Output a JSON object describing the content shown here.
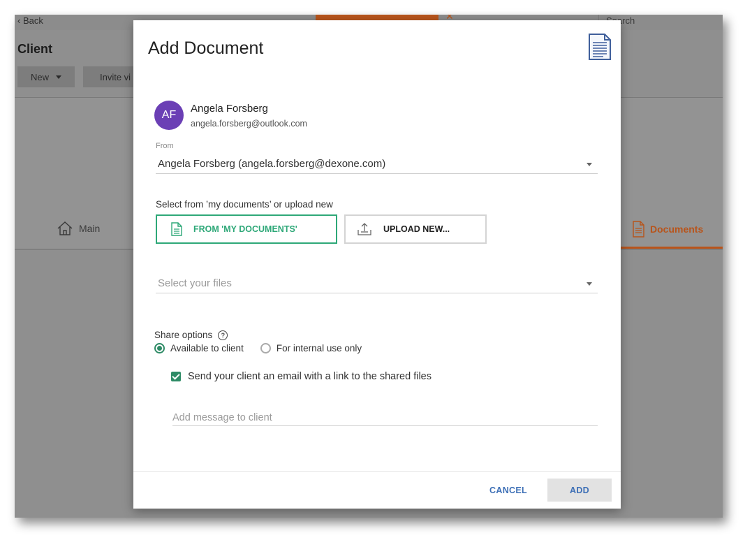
{
  "background": {
    "back_label": "Back",
    "search_placeholder": "Search",
    "page_title": "Client",
    "new_button": "New",
    "invite_button": "Invite vi",
    "tab_main": "Main",
    "tab_documents": "Documents"
  },
  "dialog": {
    "title": "Add Document",
    "client": {
      "initials": "AF",
      "name": "Angela Forsberg",
      "email": "angela.forsberg@outlook.com"
    },
    "from": {
      "label": "From",
      "value": "Angela Forsberg (angela.forsberg@dexone.com)"
    },
    "source": {
      "label": "Select from ’my documents’ or upload new",
      "my_documents_button": "FROM 'MY DOCUMENTS'",
      "upload_button": "UPLOAD NEW..."
    },
    "files": {
      "placeholder": "Select your files"
    },
    "share": {
      "label": "Share options",
      "option_client": "Available to client",
      "option_internal": "For internal use only",
      "selected": "Available to client",
      "email_checkbox_label": "Send your client an email with a link to the shared files",
      "email_checked": true,
      "message_placeholder": "Add message to client"
    },
    "footer": {
      "cancel": "CANCEL",
      "add": "ADD"
    }
  },
  "colors": {
    "accent_green": "#2ea878",
    "accent_orange": "#b8541b",
    "avatar_purple": "#6b3fb5",
    "link_blue": "#3d6fb6"
  }
}
